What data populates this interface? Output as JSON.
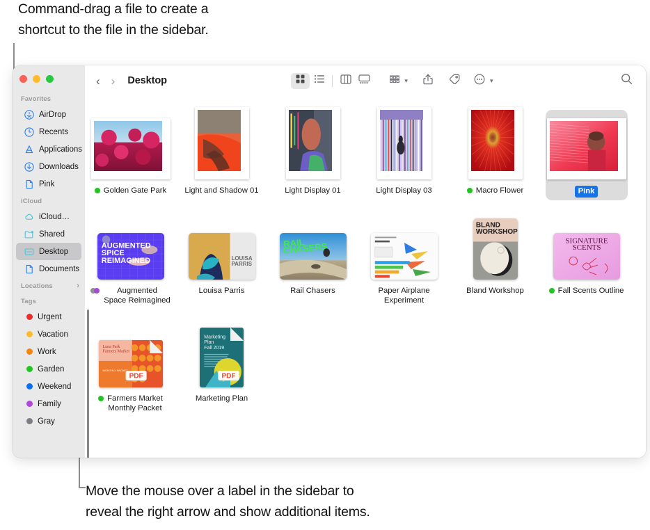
{
  "annotations": {
    "top": "Command-drag a file to create a\nshortcut to the file in the sidebar.",
    "bottom": "Move the mouse over a label in the sidebar to\nreveal the right arrow and show additional items."
  },
  "window": {
    "traffic_lights": [
      {
        "name": "close",
        "color": "#fc5f57"
      },
      {
        "name": "minimize",
        "color": "#fdbc2e"
      },
      {
        "name": "zoom",
        "color": "#28c840"
      }
    ]
  },
  "toolbar": {
    "back_label": "‹",
    "forward_label": "›",
    "title": "Desktop",
    "view_buttons": [
      {
        "name": "icon-view",
        "active": true
      },
      {
        "name": "list-view",
        "active": false
      },
      {
        "name": "column-view",
        "active": false
      },
      {
        "name": "gallery-view",
        "active": false
      }
    ],
    "group_label": "",
    "share_label": "",
    "tag_label": "",
    "more_label": "",
    "search_label": ""
  },
  "sidebar": {
    "sections": [
      {
        "title": "Favorites",
        "has_arrow": false,
        "items": [
          {
            "label": "AirDrop",
            "icon": "airdrop-icon",
            "selected": false
          },
          {
            "label": "Recents",
            "icon": "clock-icon",
            "selected": false
          },
          {
            "label": "Applications",
            "icon": "applications-icon",
            "selected": false
          },
          {
            "label": "Downloads",
            "icon": "download-icon",
            "selected": false
          },
          {
            "label": "Pink",
            "icon": "document-icon",
            "selected": false
          }
        ]
      },
      {
        "title": "iCloud",
        "has_arrow": false,
        "items": [
          {
            "label": "iCloud…",
            "icon": "cloud-icon",
            "selected": false
          },
          {
            "label": "Shared",
            "icon": "shared-folder-icon",
            "selected": false
          },
          {
            "label": "Desktop",
            "icon": "desktop-icon",
            "selected": true
          },
          {
            "label": "Documents",
            "icon": "document-icon",
            "selected": false
          }
        ]
      },
      {
        "title": "Locations",
        "has_arrow": true,
        "arrow": "›",
        "items": []
      },
      {
        "title": "Tags",
        "has_arrow": false,
        "items": [
          {
            "label": "Urgent",
            "icon": "tag-dot",
            "color": "#ec2d2e",
            "selected": false
          },
          {
            "label": "Vacation",
            "icon": "tag-dot",
            "color": "#fcbb2d",
            "selected": false
          },
          {
            "label": "Work",
            "icon": "tag-dot",
            "color": "#f6850f",
            "selected": false
          },
          {
            "label": "Garden",
            "icon": "tag-dot",
            "color": "#21c521",
            "selected": false
          },
          {
            "label": "Weekend",
            "icon": "tag-dot",
            "color": "#0b6ff5",
            "selected": false
          },
          {
            "label": "Family",
            "icon": "tag-dot",
            "color": "#b443e0",
            "selected": false
          },
          {
            "label": "Gray",
            "icon": "tag-dot",
            "color": "#7d7d82",
            "selected": false
          }
        ]
      }
    ]
  },
  "files": {
    "rows": [
      [
        {
          "name": "Golden Gate Park",
          "tag_color": "#21c521",
          "selected": false,
          "kind": "photo-landscape"
        },
        {
          "name": "Light and Shadow 01",
          "tag_color": null,
          "selected": false,
          "kind": "photo-portrait"
        },
        {
          "name": "Light Display 01",
          "tag_color": null,
          "selected": false,
          "kind": "photo-portrait"
        },
        {
          "name": "Light Display 03",
          "tag_color": null,
          "selected": false,
          "kind": "photo-portrait"
        },
        {
          "name": "Macro Flower",
          "tag_color": "#21c521",
          "selected": false,
          "kind": "photo-portrait"
        },
        {
          "name": "Pink",
          "tag_color": null,
          "selected": true,
          "kind": "photo-landscape"
        }
      ],
      [
        {
          "name": "Augmented\nSpace Reimagined",
          "tag_color": null,
          "tag_colors": [
            "#8e8e93",
            "#a849d6"
          ],
          "selected": false,
          "kind": "doc-landscape"
        },
        {
          "name": "Louisa Parris",
          "tag_color": null,
          "selected": false,
          "kind": "doc-landscape"
        },
        {
          "name": "Rail Chasers",
          "tag_color": null,
          "selected": false,
          "kind": "doc-landscape"
        },
        {
          "name": "Paper Airplane\nExperiment",
          "tag_color": null,
          "selected": false,
          "kind": "doc-landscape"
        },
        {
          "name": "Bland Workshop",
          "tag_color": null,
          "selected": false,
          "kind": "doc-portrait"
        },
        {
          "name": "Fall Scents Outline",
          "tag_color": "#21c521",
          "selected": false,
          "kind": "doc-landscape"
        }
      ],
      [
        {
          "name": "Farmers Market\nMonthly Packet",
          "tag_color": "#21c521",
          "selected": false,
          "kind": "pdf-landscape"
        },
        {
          "name": "Marketing Plan",
          "tag_color": null,
          "selected": false,
          "kind": "pdf-portrait"
        }
      ]
    ]
  }
}
